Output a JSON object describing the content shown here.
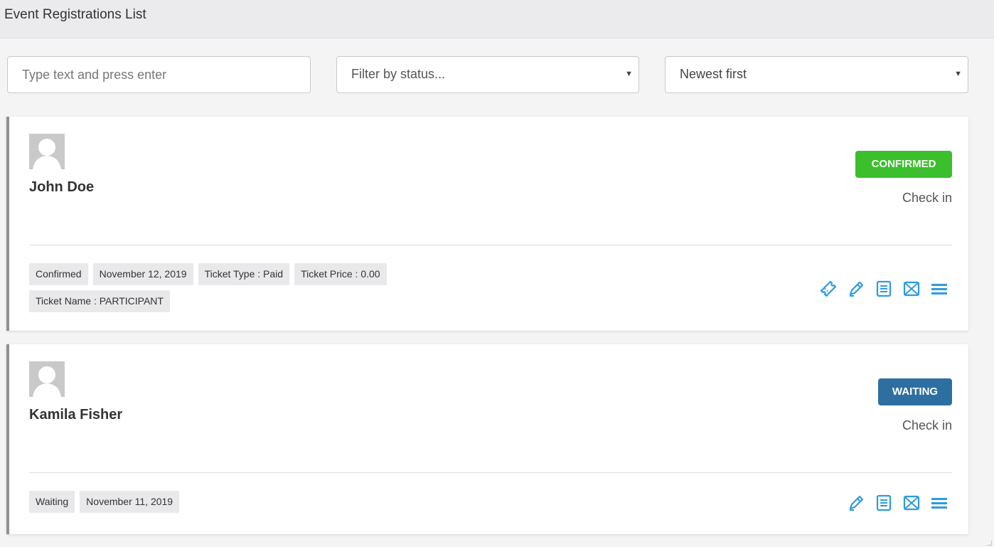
{
  "header": {
    "title": "Event Registrations List"
  },
  "filters": {
    "search_placeholder": "Type text and press enter",
    "status_placeholder": "Filter by status...",
    "sort_value": "Newest first"
  },
  "colors": {
    "confirmed": "#3bbf2c",
    "waiting": "#2d6fa0",
    "action_icon": "#2e9be0",
    "card_accent": "#8f8f92"
  },
  "registrations": [
    {
      "name": "John Doe",
      "status_badge": "CONFIRMED",
      "checkin_label": "Check in",
      "tags": [
        "Confirmed",
        "November 12, 2019",
        "Ticket Type : Paid",
        "Ticket Price : 0.00",
        "Ticket Name : PARTICIPANT"
      ],
      "actions": [
        "ticket-icon",
        "edit-icon",
        "document-icon",
        "email-icon",
        "menu-icon"
      ]
    },
    {
      "name": "Kamila Fisher",
      "status_badge": "WAITING",
      "checkin_label": "Check in",
      "tags": [
        "Waiting",
        "November 11, 2019"
      ],
      "actions": [
        "edit-icon",
        "document-icon",
        "email-icon",
        "menu-icon"
      ]
    }
  ]
}
